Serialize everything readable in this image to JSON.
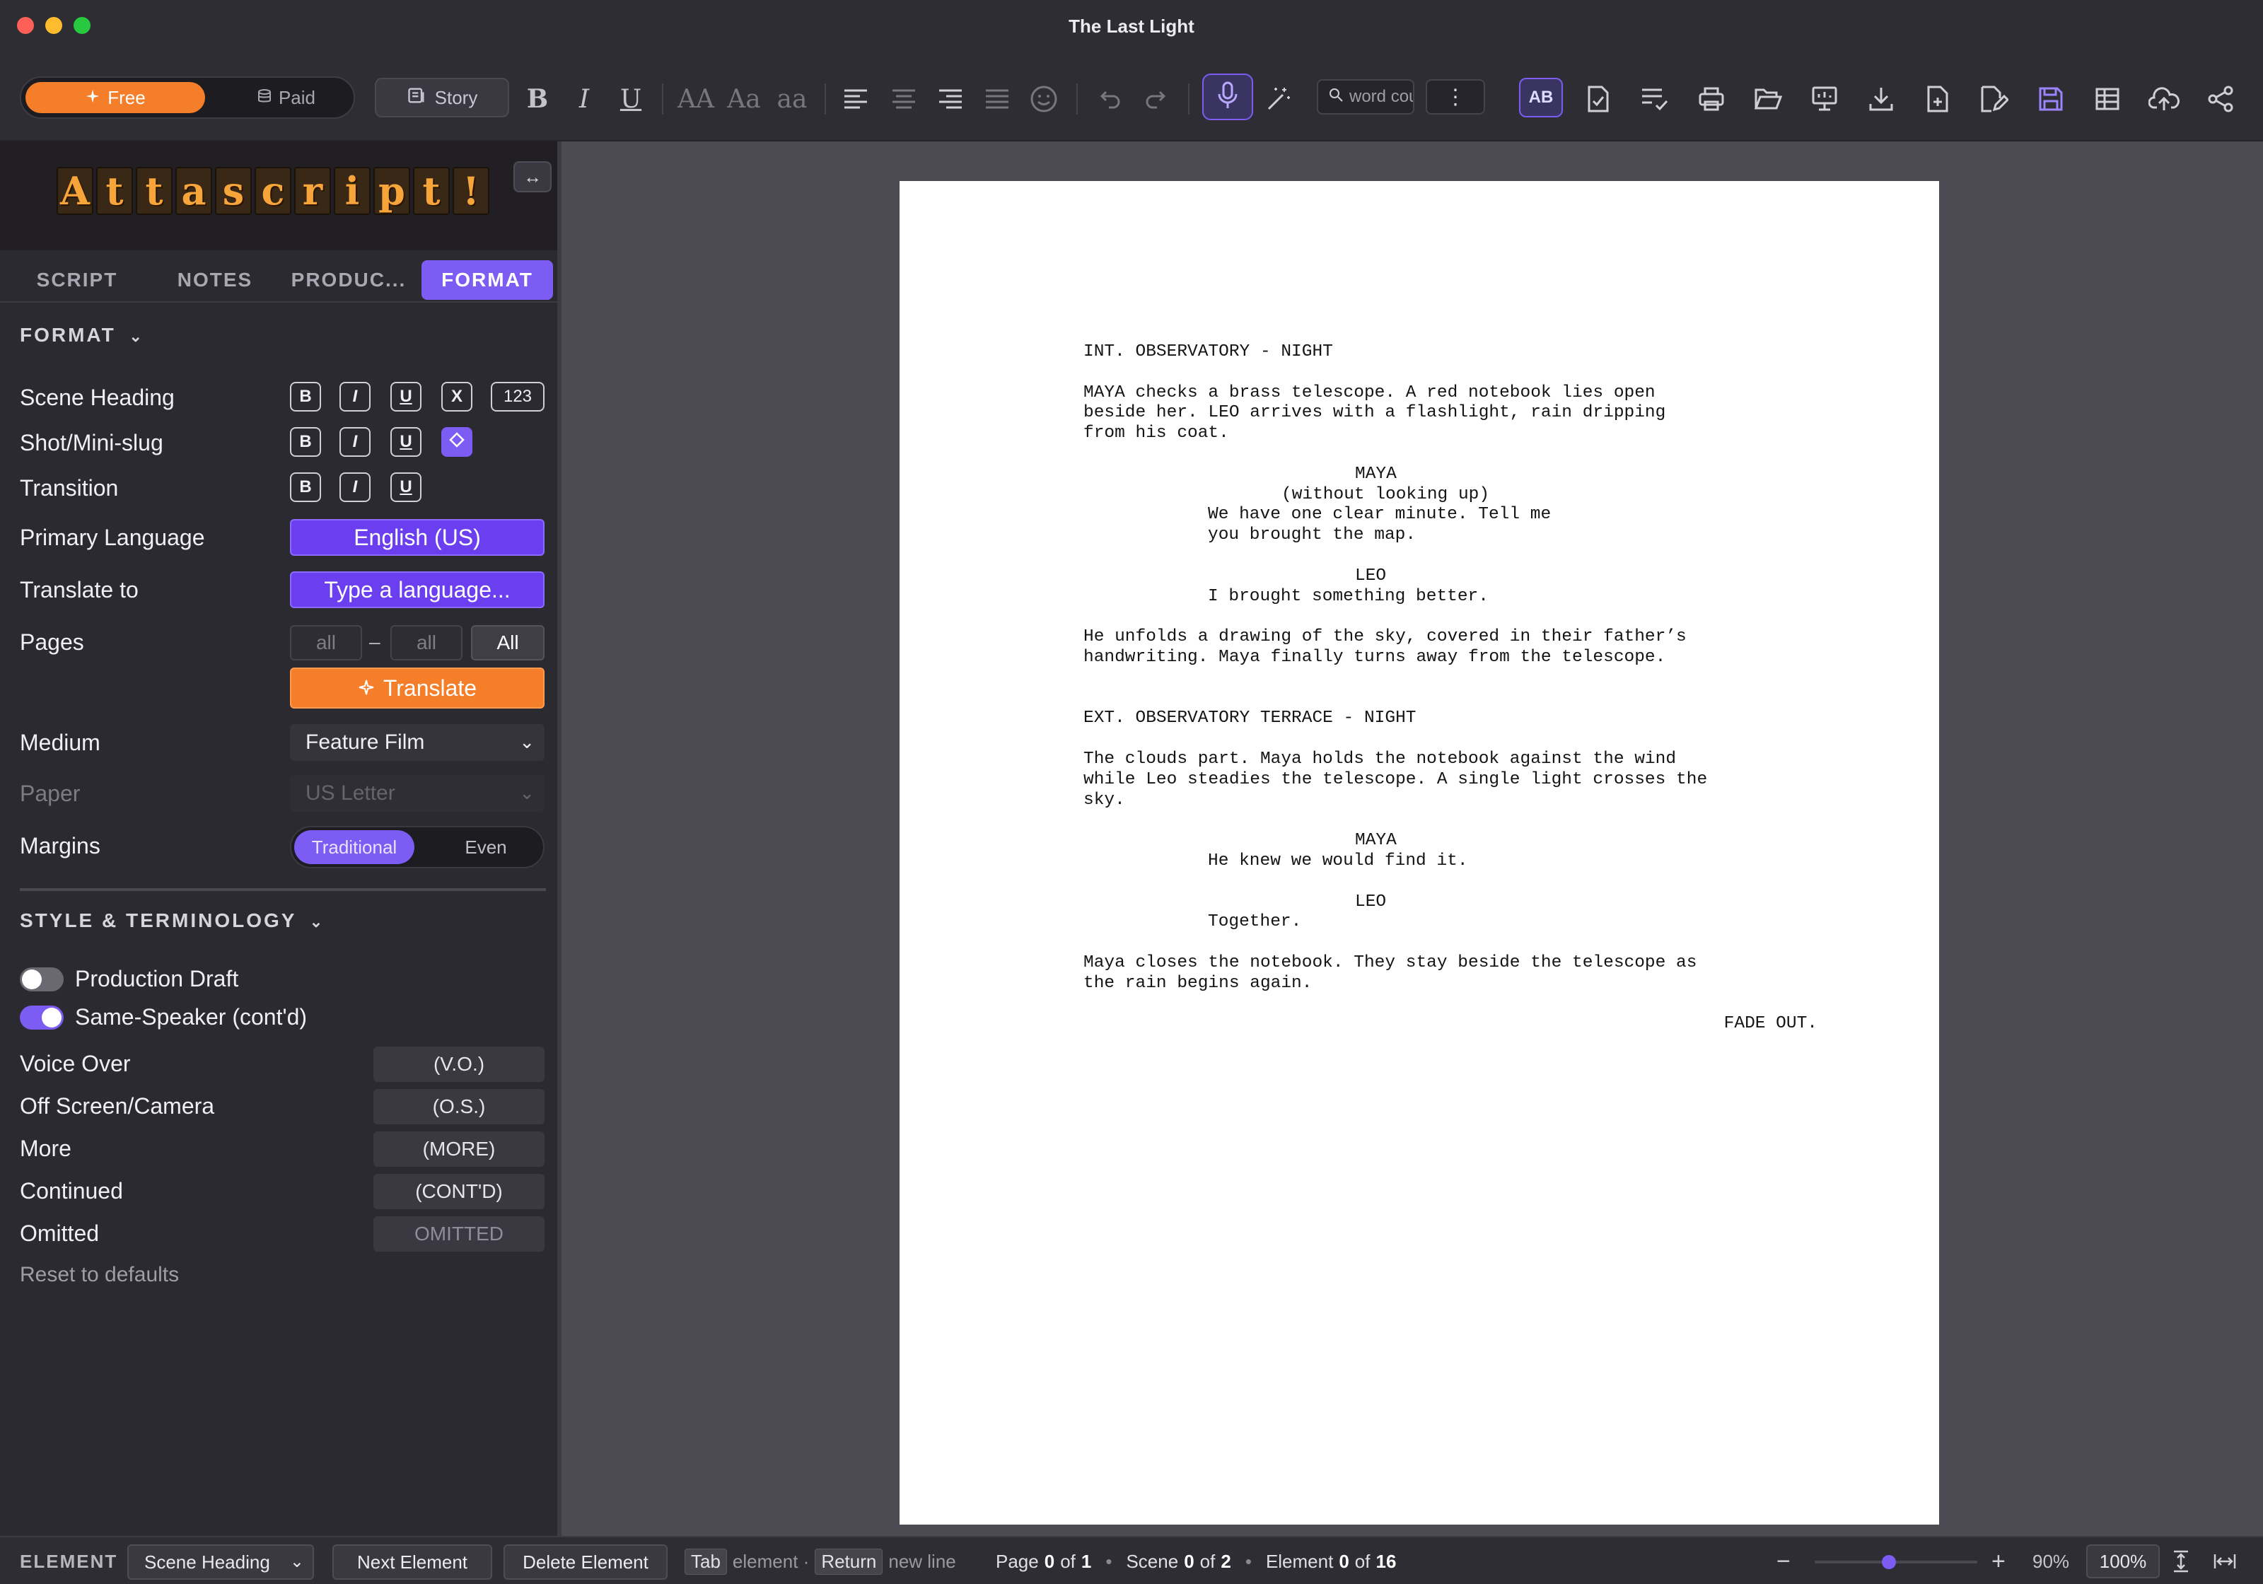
{
  "window": {
    "title": "The Last Light"
  },
  "colors": {
    "accent": "#7c5cf2",
    "orange": "#f47e2a"
  },
  "toolbar": {
    "plan_free": "Free",
    "plan_paid": "Paid",
    "story_label": "Story",
    "bold": "B",
    "italic": "I",
    "underline": "U",
    "case_upper": "AA",
    "case_title": "Aa",
    "case_lower": "aa",
    "search_placeholder": "word count",
    "ab_label": "AB",
    "more": "⋮"
  },
  "sidebar": {
    "logo_letters": [
      "A",
      "t",
      "t",
      "a",
      "s",
      "c",
      "r",
      "i",
      "p",
      "t",
      "!"
    ],
    "tabs": [
      {
        "label": "SCRIPT"
      },
      {
        "label": "NOTES"
      },
      {
        "label": "PRODUC..."
      },
      {
        "label": "FORMAT"
      }
    ],
    "format": {
      "header": "FORMAT",
      "scene_heading": "Scene Heading",
      "shot_mini_slug": "Shot/Mini-slug",
      "transition": "Transition",
      "btn_b": "B",
      "btn_i": "I",
      "btn_u": "U",
      "btn_x": "X",
      "btn_123": "123",
      "primary_language_label": "Primary Language",
      "primary_language_value": "English (US)",
      "translate_to_label": "Translate to",
      "translate_to_placeholder": "Type a language...",
      "pages_label": "Pages",
      "pages_from": "all",
      "pages_dash": "–",
      "pages_to": "all",
      "pages_all": "All",
      "translate_button": "Translate",
      "medium_label": "Medium",
      "medium_value": "Feature Film",
      "paper_label": "Paper",
      "paper_value": "US Letter",
      "margins_label": "Margins",
      "margins_traditional": "Traditional",
      "margins_even": "Even"
    },
    "style": {
      "header": "STYLE & TERMINOLOGY",
      "production_draft": "Production Draft",
      "production_draft_on": false,
      "same_speaker": "Same-Speaker (cont'd)",
      "same_speaker_on": true,
      "terms": [
        {
          "label": "Voice Over",
          "value": "(V.O.)"
        },
        {
          "label": "Off Screen/Camera",
          "value": "(O.S.)"
        },
        {
          "label": "More",
          "value": "(MORE)"
        },
        {
          "label": "Continued",
          "value": "(CONT'D)"
        },
        {
          "label": "Omitted",
          "value": "OMITTED"
        }
      ],
      "reset": "Reset to defaults"
    }
  },
  "script": {
    "lines": [
      {
        "type": "scene",
        "text": "INT. OBSERVATORY - NIGHT"
      },
      {
        "type": "action",
        "text": "MAYA checks a brass telescope. A red notebook lies open\nbeside her. LEO arrives with a flashlight, rain dripping\nfrom his coat."
      },
      {
        "type": "character",
        "text": "MAYA"
      },
      {
        "type": "parenthetical",
        "text": "(without looking up)"
      },
      {
        "type": "dialogue",
        "text": "We have one clear minute. Tell me\nyou brought the map."
      },
      {
        "type": "character",
        "text": "LEO"
      },
      {
        "type": "dialogue",
        "text": "I brought something better."
      },
      {
        "type": "action",
        "text": "He unfolds a drawing of the sky, covered in their father’s\nhandwriting. Maya finally turns away from the telescope."
      },
      {
        "type": "scene",
        "text": "EXT. OBSERVATORY TERRACE - NIGHT"
      },
      {
        "type": "action",
        "text": "The clouds part. Maya holds the notebook against the wind\nwhile Leo steadies the telescope. A single light crosses the\nsky."
      },
      {
        "type": "character",
        "text": "MAYA"
      },
      {
        "type": "dialogue",
        "text": "He knew we would find it."
      },
      {
        "type": "character",
        "text": "LEO"
      },
      {
        "type": "dialogue",
        "text": "Together."
      },
      {
        "type": "action",
        "text": "Maya closes the notebook. They stay beside the telescope as\nthe rain begins again."
      },
      {
        "type": "transition",
        "text": "FADE OUT."
      }
    ]
  },
  "status": {
    "element_label": "ELEMENT",
    "element_value": "Scene Heading",
    "next_element": "Next Element",
    "delete_element": "Delete Element",
    "tab_key": "Tab",
    "tab_desc": "element ·",
    "return_key": "Return",
    "return_desc": "new line",
    "page_word": "Page",
    "page_cur": "0",
    "page_of": "of",
    "page_total": "1",
    "scene_word": "Scene",
    "scene_cur": "0",
    "scene_of": "of",
    "scene_total": "2",
    "element_word": "Element",
    "element_cur": "0",
    "element_of": "of",
    "element_total": "16",
    "zoom_level": 0.45,
    "zoom_pct": "90%",
    "zoom_dropdown": "100%"
  }
}
